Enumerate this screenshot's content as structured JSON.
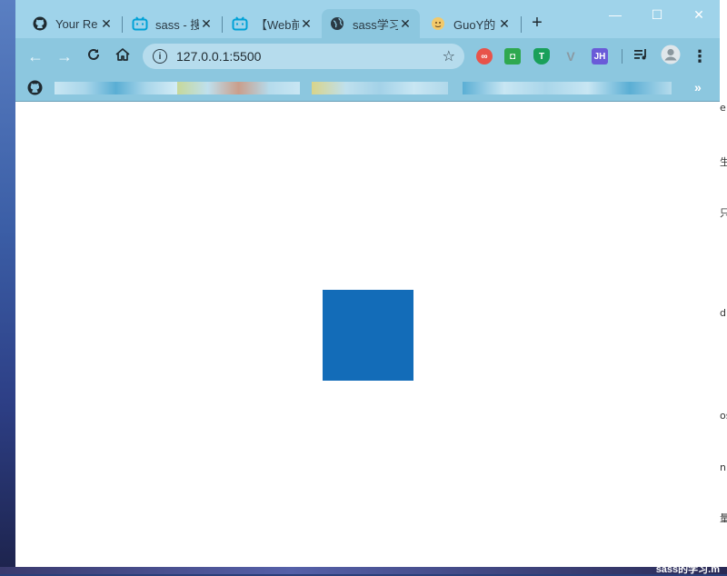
{
  "browser": {
    "tabs": [
      {
        "title": "Your Re",
        "icon": "github-icon"
      },
      {
        "title": "sass - 搜",
        "icon": "bilibili-icon"
      },
      {
        "title": "【Web前",
        "icon": "bilibili-icon"
      },
      {
        "title": "sass学习",
        "icon": "globe-icon",
        "active": true
      },
      {
        "title": "GuoY的",
        "icon": "avatar-icon"
      }
    ],
    "new_tab_symbol": "+",
    "window_controls": {
      "minimize": "—",
      "maximize": "☐",
      "close": "✕"
    },
    "address": {
      "url": "127.0.0.1:5500"
    },
    "extensions": [
      {
        "name": "infinity-extension-icon",
        "label": "∞",
        "color": "#e8534a"
      },
      {
        "name": "green-square-extension-icon",
        "label": "◘",
        "color": "#2fa84f"
      },
      {
        "name": "t-shield-extension-icon",
        "label": "T",
        "color": "#19a05a"
      },
      {
        "name": "vue-devtools-extension-icon",
        "label": "V",
        "color": "#8a9aa3"
      },
      {
        "name": "jh-extension-icon",
        "label": "JH",
        "color": "#6a5bd8"
      }
    ],
    "bookmarks_overflow": "»"
  },
  "page": {
    "box_color": "#136cb8"
  },
  "desktop": {
    "right_fragments": [
      "e",
      "生",
      "只",
      "d",
      "os",
      "n",
      "量"
    ],
    "bottom_caption": "sass的学习.m"
  },
  "colors": {
    "tabbar": "#9fd3ea",
    "toolbar": "#8cc7df",
    "accent_box": "#136cb8"
  }
}
